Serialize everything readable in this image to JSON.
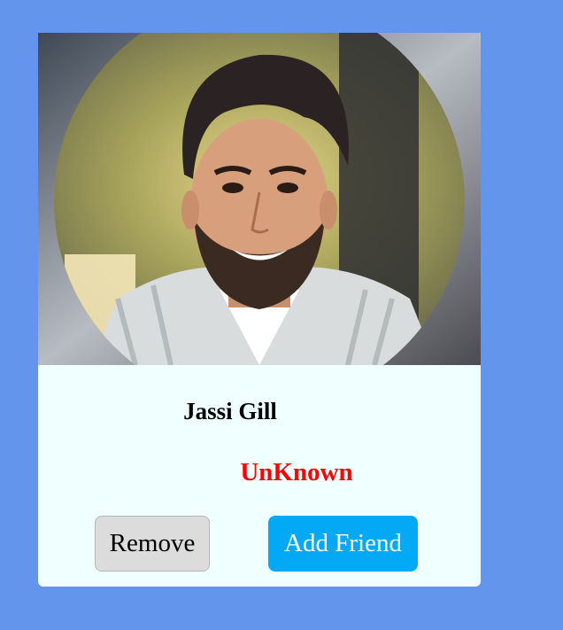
{
  "profile": {
    "name": "Jassi Gill",
    "status": "UnKnown",
    "status_color": "#ff0000"
  },
  "actions": {
    "remove_label": "Remove",
    "add_friend_label": "Add Friend"
  },
  "colors": {
    "page_background": "#6495ed",
    "card_background": "#f0ffff",
    "remove_button": "#dcdcdc",
    "add_button": "#03a9f4"
  }
}
